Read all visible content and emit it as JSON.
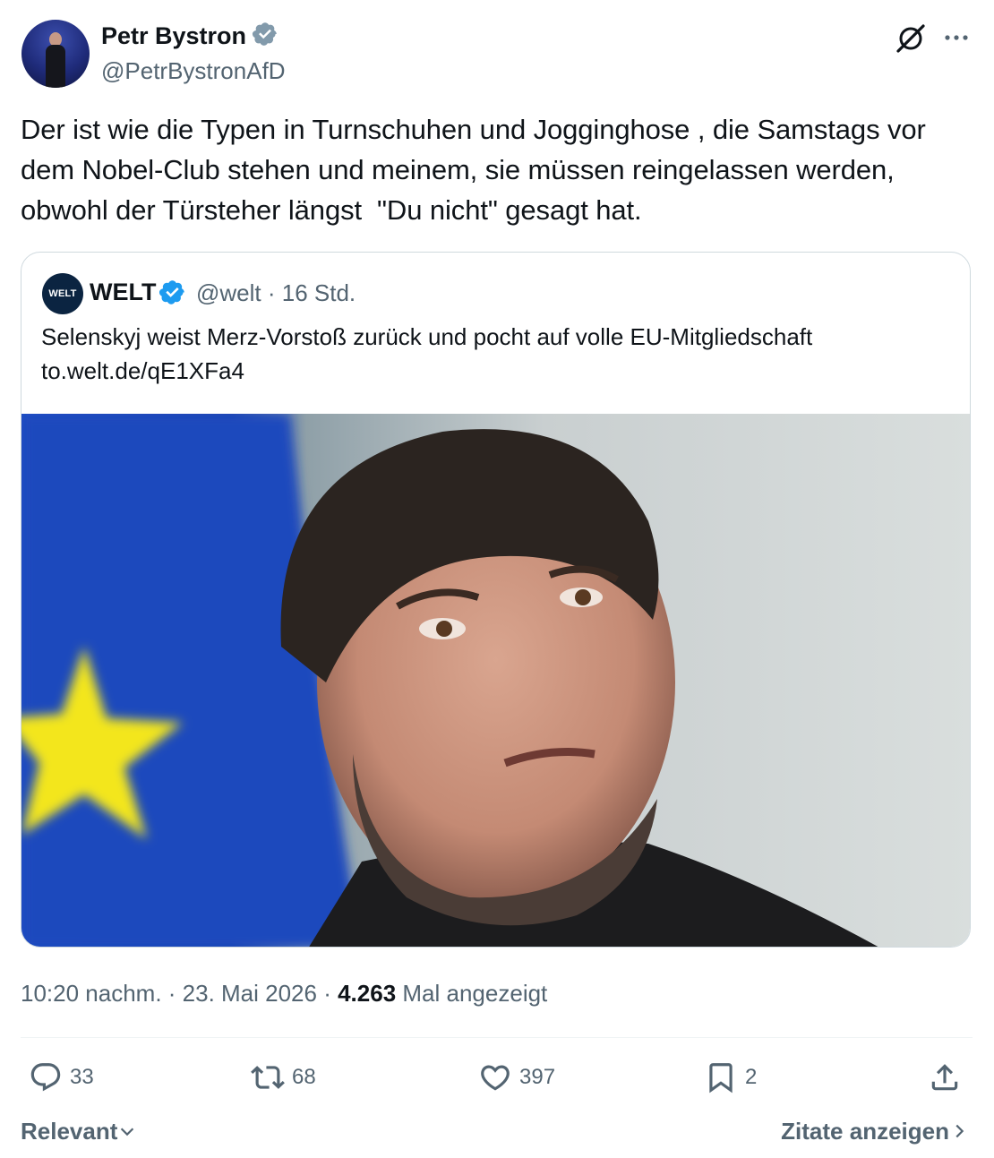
{
  "author": {
    "name": "Petr Bystron",
    "handle": "@PetrBystronAfD",
    "verified_icon": "verified-badge-gray"
  },
  "tweet": {
    "text": "Der ist wie die Typen in Turnschuhen und Jogginghose , die Samstags vor dem Nobel-Club stehen und meinem, sie müssen reingelassen werden, obwohl der Türsteher längst  \"Du nicht\" gesagt hat."
  },
  "quote": {
    "avatar_text": "WELT",
    "name": "WELT",
    "handle_time": "@welt · 16 Std.",
    "text_line1": "Selenskyj weist Merz-Vorstoß zurück und pocht auf volle EU-Mitgliedschaft",
    "text_line2": "to.welt.de/qE1XFa4"
  },
  "meta": {
    "time": "10:20 nachm. · 23. Mai 2026 · ",
    "views": "4.263",
    "views_label": " Mal angezeigt"
  },
  "actions": {
    "replies": "33",
    "reposts": "68",
    "likes": "397",
    "bookmarks": "2"
  },
  "footer": {
    "sort_label": "Relevant",
    "quotes_label": "Zitate anzeigen"
  },
  "colors": {
    "text": "#0f1419",
    "muted": "#536471",
    "verified_blue": "#1d9bf0",
    "verified_gray": "#829aab"
  }
}
